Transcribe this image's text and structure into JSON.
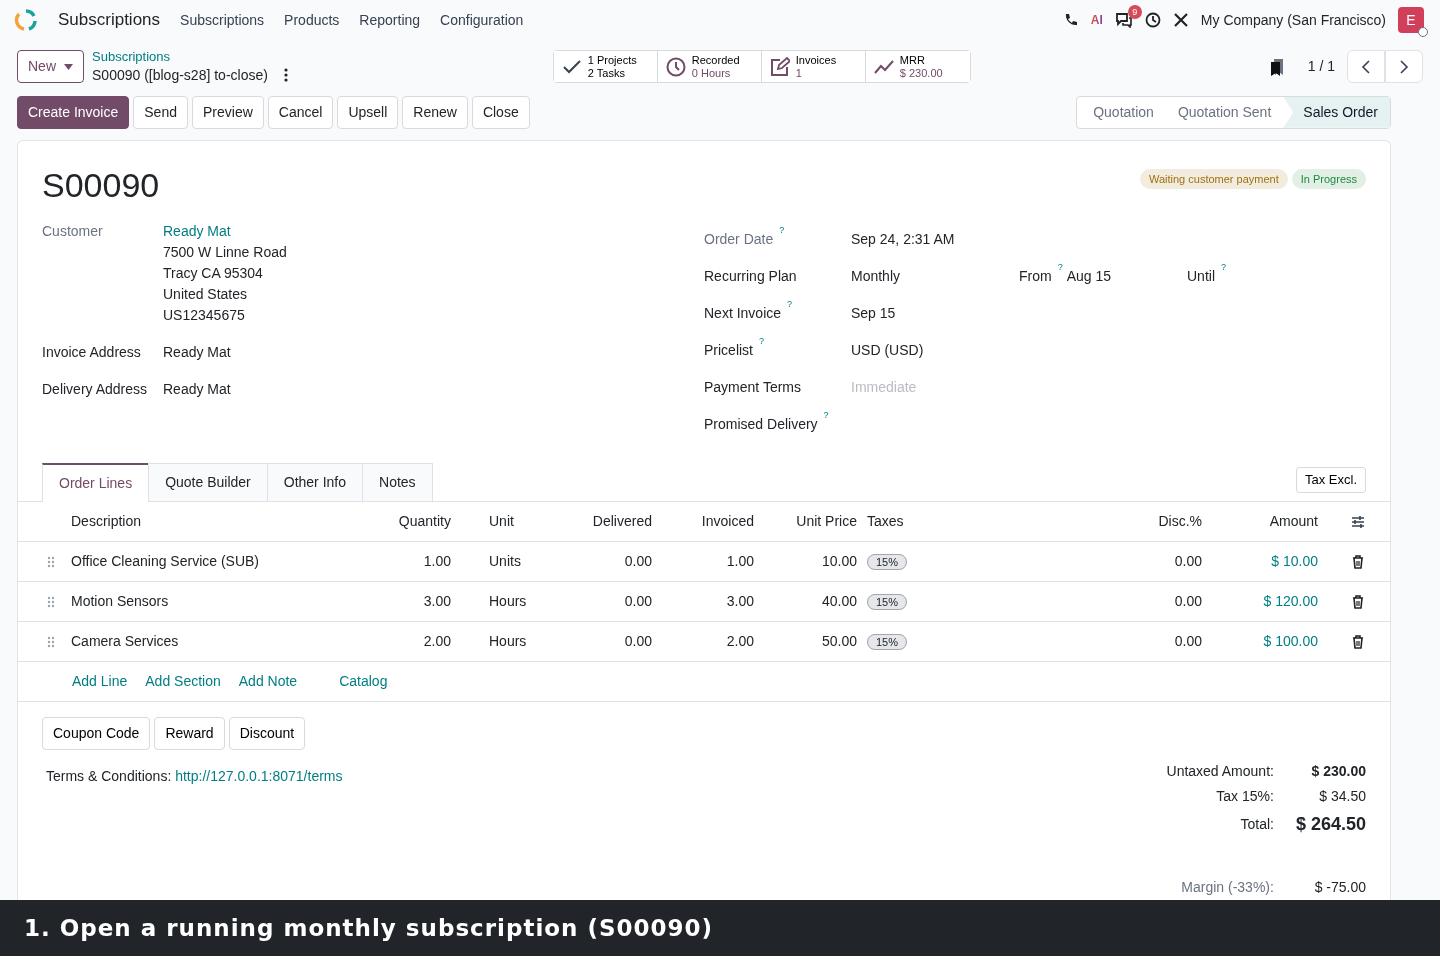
{
  "app": {
    "name": "Subscriptions",
    "menu": [
      "Subscriptions",
      "Products",
      "Reporting",
      "Configuration"
    ]
  },
  "systray": {
    "ai_label": "AI",
    "notification_count": "9",
    "company": "My Company (San Francisco)",
    "avatar": "E"
  },
  "control_panel": {
    "new_button": "New",
    "breadcrumb": "Subscriptions",
    "record_title": "S00090 ([blog-s28] to-close)",
    "pager": "1 / 1"
  },
  "smart_buttons": [
    {
      "kind": "tasks",
      "lines": [
        "1 Projects",
        "2 Tasks"
      ]
    },
    {
      "kind": "time",
      "lines": [
        "Recorded",
        "0 Hours"
      ]
    },
    {
      "kind": "invoices",
      "lines": [
        "Invoices",
        "1"
      ]
    },
    {
      "kind": "mrr",
      "lines": [
        "MRR",
        "$ 230.00"
      ]
    }
  ],
  "action_buttons": [
    {
      "label": "Create Invoice",
      "primary": true
    },
    {
      "label": "Send",
      "primary": false
    },
    {
      "label": "Preview",
      "primary": false
    },
    {
      "label": "Cancel",
      "primary": false
    },
    {
      "label": "Upsell",
      "primary": false
    },
    {
      "label": "Renew",
      "primary": false
    },
    {
      "label": "Close",
      "primary": false
    }
  ],
  "status_bar": [
    {
      "label": "Quotation",
      "selected": false
    },
    {
      "label": "Quotation Sent",
      "selected": false
    },
    {
      "label": "Sales Order",
      "selected": true
    }
  ],
  "form": {
    "title": "S00090",
    "tags": [
      {
        "label": "Waiting customer payment",
        "color": "#a0700f"
      },
      {
        "label": "In Progress",
        "color": "#1f8a3f"
      }
    ],
    "left_fields": [
      {
        "label": "Customer",
        "muted": true,
        "value": "Ready Mat",
        "link": true,
        "lines": [
          "7500 W Linne Road",
          "Tracy CA 95304",
          "United States",
          "US12345675"
        ]
      },
      {
        "label": "Invoice Address",
        "muted": false,
        "value": "Ready Mat",
        "link": false
      },
      {
        "label": "Delivery Address",
        "muted": false,
        "value": "Ready Mat",
        "link": false
      }
    ],
    "right_fields": [
      {
        "label": "Order Date",
        "muted": true,
        "help": "?",
        "value": "Sep 24, 2:31 AM"
      },
      {
        "label": "Recurring Plan",
        "muted": false,
        "value": "Monthly",
        "extra": [
          {
            "label": "From",
            "help": "?",
            "value": "Aug 15"
          },
          {
            "label": "Until",
            "help": "?"
          }
        ]
      },
      {
        "label": "Next Invoice",
        "muted": false,
        "help": "?",
        "value": "Sep 15"
      },
      {
        "label": "Pricelist",
        "muted": false,
        "help": "?",
        "value": "USD (USD)"
      },
      {
        "label": "Payment Terms",
        "muted": false,
        "placeholder": "Immediate"
      },
      {
        "label": "Promised Delivery",
        "muted": false,
        "help": "?"
      }
    ]
  },
  "tabs": [
    {
      "label": "Order Lines",
      "selected": true
    },
    {
      "label": "Quote Builder",
      "selected": false
    },
    {
      "label": "Other Info",
      "selected": false
    },
    {
      "label": "Notes",
      "selected": false
    }
  ],
  "tax_button": "Tax Excl.",
  "table": {
    "columns": [
      "Description",
      "Quantity",
      "Unit",
      "Delivered",
      "Invoiced",
      "Unit Price",
      "Taxes",
      "Disc.%",
      "Amount"
    ],
    "rows": [
      [
        "Office Cleaning Service (SUB)",
        "1.00",
        "Units",
        "0.00",
        "1.00",
        "10.00",
        "15%",
        "0.00",
        "$ 10.00"
      ],
      [
        "Motion Sensors",
        "3.00",
        "Hours",
        "0.00",
        "3.00",
        "40.00",
        "15%",
        "0.00",
        "$ 120.00"
      ],
      [
        "Camera Services",
        "2.00",
        "Hours",
        "0.00",
        "2.00",
        "50.00",
        "15%",
        "0.00",
        "$ 100.00"
      ]
    ]
  },
  "line_actions": [
    "Add Line",
    "Add Section",
    "Add Note",
    "Catalog"
  ],
  "promo_buttons": [
    "Coupon Code",
    "Reward",
    "Discount"
  ],
  "terms": {
    "label": "Terms & Conditions:",
    "link": "http://127.0.0.1:8071/terms"
  },
  "totals": [
    {
      "kind": "strong",
      "label": "Untaxed Amount:",
      "value": "$ 230.00"
    },
    {
      "kind": "plain",
      "label": "Tax 15%:",
      "value": "$ 34.50"
    },
    {
      "kind": "total",
      "label": "Total:",
      "value": "$ 264.50"
    },
    {
      "kind": "margin",
      "label": "Margin (-33%):",
      "value": "$ -75.00"
    }
  ],
  "caption": "1. Open a running monthly subscription (S00090)"
}
